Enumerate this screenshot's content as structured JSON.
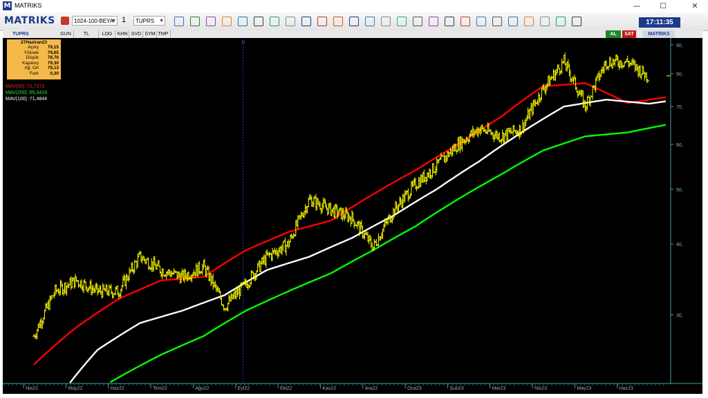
{
  "window": {
    "title": "MATRIKS",
    "minimize": "—",
    "maximize": "☐",
    "close": "✕"
  },
  "toolbar": {
    "brand": "MATRIKS",
    "layout_combo": "1024-100-BEYA",
    "window_number": "1",
    "symbol_combo": "TUPRS",
    "clock": "17:11:35"
  },
  "chart_tabs": [
    "GUN",
    "TL",
    "LOG",
    "KHN",
    "SVD",
    "SYM",
    "TMP"
  ],
  "chart_header": {
    "symbol": "TUPRS",
    "al": "AL",
    "sat": "SAT",
    "brand": "MATRIKS"
  },
  "info_box": {
    "date": "27Haziran23",
    "rows": [
      {
        "label": "Açılış",
        "value": "79,15"
      },
      {
        "label": "Yüksek",
        "value": "79,65"
      },
      {
        "label": "Düşük",
        "value": "78,70"
      },
      {
        "label": "Kapanış",
        "value": "79,30"
      },
      {
        "label": "Ağ. Ort",
        "value": "79,13"
      },
      {
        "label": "Fark",
        "value": "0,30"
      }
    ]
  },
  "colors": {
    "price": "#ffff00",
    "mav50": "#ff0000",
    "mav200": "#00ff00",
    "mav100": "#ffffff",
    "axis": "#4a9aa8"
  },
  "chart_data": {
    "type": "line",
    "title": "",
    "x_tick_labels": [
      "Nis22",
      "May22",
      "Haz22",
      "Tem22",
      "Ağu22",
      "Eyl22",
      "Eki22",
      "Kas22",
      "Ara22",
      "Oca23",
      "Şub23",
      "Mar23",
      "Nis23",
      "May23",
      "Haz23"
    ],
    "y_tick_labels": [
      "30,",
      "40,",
      "50,",
      "60,",
      "70,",
      "80,",
      "90,"
    ],
    "ylim": [
      23,
      92
    ],
    "marker_label": "D",
    "legend": [
      {
        "name": "MAV(50)",
        "value": ":72,7272"
      },
      {
        "name": "MAV(200)",
        "value": ":65,0415"
      },
      {
        "name": "MAV(100)",
        "value": ":71,4844"
      }
    ],
    "series": [
      {
        "name": "price",
        "x": [
          0,
          0.5,
          1,
          1.5,
          2,
          2.5,
          3,
          3.5,
          4,
          4.5,
          5,
          5.5,
          6,
          6.5,
          7,
          7.5,
          8,
          8.5,
          9,
          9.5,
          10,
          10.5,
          11,
          11.5,
          12,
          12.5,
          13,
          13.5,
          14,
          14.5
        ],
        "values": [
          27.5,
          33,
          34.5,
          33,
          33,
          38,
          36,
          35,
          36.5,
          31,
          34,
          38,
          40,
          48,
          46,
          44.5,
          39.5,
          46,
          51,
          55,
          60,
          64,
          62,
          64,
          75,
          84,
          70,
          84,
          84,
          79
        ]
      },
      {
        "name": "MAV(50)",
        "x": [
          0,
          1,
          2,
          3,
          4,
          5,
          6,
          7,
          8,
          9,
          10,
          11,
          12,
          13,
          14,
          14.9
        ],
        "values": [
          24.5,
          28.5,
          32,
          34.5,
          35,
          39,
          42,
          44,
          49,
          54,
          60,
          67,
          76,
          77,
          71,
          72.7
        ]
      },
      {
        "name": "MAV(100)",
        "x": [
          0.8,
          1.5,
          2.5,
          3.5,
          4.5,
          5.5,
          6.5,
          7.5,
          8.5,
          9.5,
          10.5,
          11.5,
          12.5,
          13.5,
          14.5,
          14.9
        ],
        "values": [
          22.5,
          26,
          29,
          30.5,
          32.5,
          36,
          38,
          41,
          45,
          50,
          56,
          63,
          70,
          72,
          70.8,
          71.5
        ]
      },
      {
        "name": "MAV(200)",
        "x": [
          1.8,
          3,
          4,
          5,
          6,
          7,
          8,
          9,
          10,
          11,
          12,
          13,
          14,
          14.9
        ],
        "values": [
          22.8,
          25.5,
          27.5,
          30.5,
          33,
          35.5,
          39,
          43,
          48,
          53,
          58.5,
          62,
          63,
          65
        ]
      }
    ]
  }
}
